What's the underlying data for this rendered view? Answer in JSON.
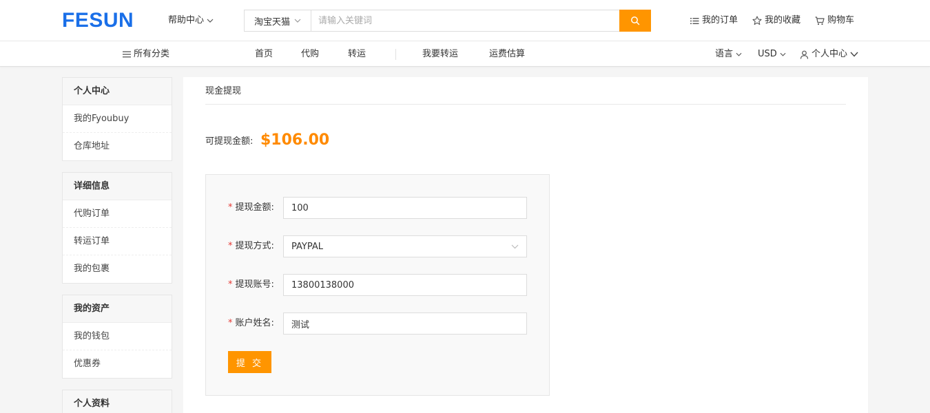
{
  "header": {
    "logo": "FESUN",
    "help_center": "帮助中心",
    "search": {
      "category": "淘宝天猫",
      "placeholder": "请输入关键词"
    },
    "links": {
      "orders": "我的订单",
      "favorites": "我的收藏",
      "cart": "购物车"
    }
  },
  "nav": {
    "all_categories": "所有分类",
    "home": "首页",
    "purchase_agent": "代购",
    "forwarding": "转运",
    "ship_request": "我要转运",
    "shipping_estimate": "运费估算",
    "language": "语言",
    "currency": "USD",
    "user_center": "个人中心"
  },
  "sidebar": {
    "groups": [
      {
        "title": "个人中心",
        "items": [
          "我的Fyoubuy",
          "仓库地址"
        ]
      },
      {
        "title": "详细信息",
        "items": [
          "代购订单",
          "转运订单",
          "我的包裹"
        ]
      },
      {
        "title": "我的资产",
        "items": [
          "我的钱包",
          "优惠券"
        ]
      },
      {
        "title": "个人资料",
        "items": []
      }
    ]
  },
  "main": {
    "page_title": "现金提现",
    "balance_label": "可提现金额:",
    "balance_value": "$106.00",
    "form": {
      "required_mark": "*",
      "amount_label": "提现金额:",
      "amount_value": "100",
      "method_label": "提现方式:",
      "method_value": "PAYPAL",
      "account_label": "提现账号:",
      "account_value": "13800138000",
      "name_label": "账户姓名:",
      "name_value": "测试",
      "submit": "提 交"
    }
  },
  "colors": {
    "brand_blue": "#1a6fe8",
    "accent_orange": "#ff9500",
    "balance_orange": "#ff8a00",
    "required_red": "#e53935"
  }
}
